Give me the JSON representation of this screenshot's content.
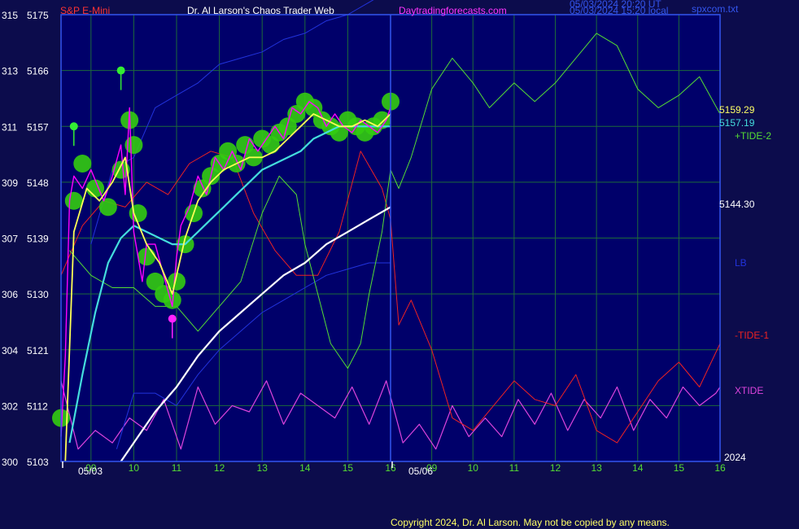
{
  "header": {
    "instrument": "S&P E-Mini",
    "author": "Dr. Al Larson's Chaos Trader Web",
    "site": "Daytradingforecasts.com",
    "ut_time": "05/03/2024 20:20 UT",
    "local_time": "05/03/2024 15:20 local",
    "file": "spxcom.txt"
  },
  "copyright": "Copyright 2024, Dr. Al Larson. May not be copied by any means.",
  "colors": {
    "background": "#0c0c4c",
    "plot_bg": "#00006a",
    "grid": "#1d6a3a",
    "price": "#ff00ff",
    "bubble": "#33cc11",
    "fast_ma": "#ffff55",
    "slow_ma": "#44dddd",
    "long_ma": "#ffffff",
    "tide2": "#55dd33",
    "tide1": "#ee2222",
    "xtide": "#dd44dd",
    "lb": "#2233dd",
    "header_red": "#ff3333",
    "header_white": "#ffffff",
    "header_magenta": "#ff33ff"
  },
  "chart_data": {
    "type": "line",
    "title": "S&P E-Mini",
    "x_ticks_day1": [
      "09",
      "10",
      "11",
      "12",
      "13",
      "14",
      "15",
      "16"
    ],
    "x_ticks_day2": [
      "09",
      "10",
      "11",
      "12",
      "13",
      "14",
      "15",
      "16"
    ],
    "date_labels": [
      "05/03",
      "05/06"
    ],
    "year_label": "2024",
    "y_left_outer": [
      300,
      302,
      304,
      306,
      307,
      309,
      311,
      313,
      315
    ],
    "y_left_inner": [
      5103,
      5112,
      5121,
      5130,
      5139,
      5148,
      5157,
      5166,
      5175
    ],
    "ylim": [
      5103,
      5175
    ],
    "right_labels": {
      "last_price": "5159.29",
      "slow_ma_value": "5157.19",
      "tide2": "+TIDE-2",
      "long_ma_value": "5144.30",
      "lb": "LB",
      "tide1": "-TIDE-1",
      "xtide": "XTIDE"
    },
    "series": [
      {
        "name": "Price",
        "key": "price",
        "x": [
          8.3,
          8.4,
          8.5,
          8.6,
          8.8,
          9.0,
          9.3,
          9.5,
          9.7,
          9.8,
          9.9,
          10.0,
          10.2,
          10.3,
          10.5,
          10.7,
          10.9,
          11.0,
          11.1,
          11.3,
          11.5,
          11.7,
          11.9,
          12.1,
          12.3,
          12.5,
          12.7,
          12.9,
          13.1,
          13.3,
          13.5,
          13.7,
          13.9,
          14.1,
          14.3,
          14.5,
          14.7,
          14.9,
          15.1,
          15.3,
          15.5,
          15.7,
          15.9,
          16.0
        ],
        "y": [
          5107,
          5120,
          5145,
          5149,
          5147,
          5150,
          5145,
          5149,
          5154,
          5146,
          5160,
          5140,
          5132,
          5138,
          5138,
          5133,
          5128,
          5136,
          5141,
          5144,
          5149,
          5146,
          5152,
          5150,
          5153,
          5150,
          5155,
          5153,
          5155,
          5157,
          5155,
          5160,
          5159,
          5161,
          5160,
          5157,
          5159,
          5157,
          5156,
          5158,
          5157,
          5156,
          5158,
          5160
        ]
      },
      {
        "name": "Fast MA",
        "key": "fast_ma",
        "x": [
          8.4,
          8.6,
          8.9,
          9.2,
          9.5,
          9.8,
          10.0,
          10.3,
          10.6,
          10.9,
          11.2,
          11.5,
          11.8,
          12.1,
          12.4,
          12.7,
          13.0,
          13.3,
          13.6,
          13.9,
          14.2,
          14.5,
          14.8,
          15.1,
          15.4,
          15.7,
          16.0
        ],
        "y": [
          5103,
          5140,
          5147,
          5145,
          5148,
          5152,
          5143,
          5138,
          5135,
          5130,
          5139,
          5145,
          5148,
          5150,
          5151,
          5152,
          5152,
          5153,
          5155,
          5157,
          5159,
          5158,
          5157,
          5157,
          5158,
          5157,
          5159
        ]
      },
      {
        "name": "Slow MA",
        "key": "slow_ma",
        "x": [
          8.5,
          8.8,
          9.1,
          9.4,
          9.7,
          10.0,
          10.3,
          10.6,
          10.9,
          11.2,
          11.5,
          11.8,
          12.1,
          12.4,
          12.7,
          13.0,
          13.3,
          13.6,
          13.9,
          14.2,
          14.5,
          14.8,
          15.1,
          15.4,
          15.7,
          16.0
        ],
        "y": [
          5106,
          5117,
          5127,
          5135,
          5139,
          5141,
          5140,
          5139,
          5138,
          5138,
          5140,
          5142,
          5144,
          5146,
          5148,
          5150,
          5151,
          5152,
          5153,
          5155,
          5156,
          5157,
          5157,
          5157,
          5157,
          5157
        ]
      },
      {
        "name": "Long MA",
        "key": "long_ma",
        "x": [
          9.7,
          10.0,
          10.5,
          11.0,
          11.5,
          12.0,
          12.5,
          13.0,
          13.5,
          14.0,
          14.5,
          15.0,
          15.5,
          16.0
        ],
        "y": [
          5103,
          5106,
          5111,
          5115,
          5120,
          5124,
          5127,
          5130,
          5133,
          5135,
          5138,
          5140,
          5142,
          5144
        ]
      },
      {
        "name": "TIDE-2",
        "key": "tide2",
        "x": [
          8.5,
          9.0,
          9.5,
          10.0,
          10.5,
          11.0,
          11.5,
          12.0,
          12.5,
          13.0,
          13.4,
          13.8,
          14.0,
          14.3,
          14.6,
          15.0,
          15.3,
          15.5,
          15.8,
          16.0,
          16.2,
          16.5,
          17.0,
          17.5,
          18.0,
          18.4,
          19.0,
          19.5,
          20.0,
          20.5,
          21.0,
          21.5,
          22.0,
          22.5,
          23.0,
          23.5,
          24.0
        ],
        "y": [
          5137,
          5133,
          5131,
          5131,
          5128,
          5128,
          5124,
          5128,
          5132,
          5143,
          5149,
          5146,
          5138,
          5130,
          5122,
          5118,
          5122,
          5130,
          5140,
          5150,
          5147,
          5152,
          5163,
          5168,
          5164,
          5160,
          5164,
          5161,
          5164,
          5168,
          5172,
          5170,
          5163,
          5160,
          5162,
          5165,
          5159
        ]
      },
      {
        "name": "TIDE-1",
        "key": "tide1",
        "x": [
          8.3,
          8.8,
          9.3,
          9.8,
          10.3,
          10.8,
          11.3,
          11.8,
          12.3,
          12.8,
          13.3,
          13.8,
          14.3,
          14.8,
          15.3,
          15.8,
          16.0,
          16.2,
          16.5,
          17.0,
          17.5,
          18.0,
          18.5,
          19.0,
          19.5,
          20.0,
          20.5,
          21.0,
          21.5,
          22.0,
          22.5,
          23.0,
          23.5,
          24.0
        ],
        "y": [
          5133,
          5141,
          5145,
          5144,
          5148,
          5146,
          5151,
          5153,
          5152,
          5143,
          5137,
          5133,
          5133,
          5140,
          5153,
          5147,
          5142,
          5125,
          5129,
          5121,
          5110,
          5108,
          5112,
          5116,
          5113,
          5112,
          5117,
          5108,
          5106,
          5111,
          5116,
          5119,
          5115,
          5122
        ]
      },
      {
        "name": "XTIDE",
        "key": "xtide",
        "x": [
          8.3,
          8.7,
          9.1,
          9.5,
          9.9,
          10.3,
          10.7,
          11.1,
          11.5,
          11.9,
          12.3,
          12.7,
          13.1,
          13.5,
          13.9,
          14.3,
          14.7,
          15.1,
          15.5,
          15.9,
          16.3,
          16.7,
          17.1,
          17.5,
          17.9,
          18.3,
          18.7,
          19.1,
          19.5,
          19.9,
          20.3,
          20.7,
          21.1,
          21.5,
          21.9,
          22.3,
          22.7,
          23.1,
          23.5,
          23.9,
          24.0
        ],
        "y": [
          5116,
          5105,
          5108,
          5106,
          5110,
          5108,
          5113,
          5105,
          5115,
          5109,
          5112,
          5111,
          5116,
          5109,
          5114,
          5112,
          5110,
          5115,
          5109,
          5116,
          5106,
          5109,
          5105,
          5112,
          5107,
          5110,
          5107,
          5113,
          5109,
          5114,
          5108,
          5113,
          5110,
          5115,
          5108,
          5113,
          5110,
          5115,
          5112,
          5114,
          5115
        ]
      },
      {
        "name": "LB Upper",
        "key": "lb",
        "x": [
          9.0,
          9.5,
          10.0,
          10.5,
          11.0,
          11.5,
          12.0,
          12.5,
          13.0,
          13.5,
          14.0,
          14.5,
          15.0,
          15.5,
          16.0
        ],
        "y": [
          5138,
          5150,
          5152,
          5160,
          5162,
          5164,
          5167,
          5168,
          5169,
          5171,
          5172,
          5174,
          5175,
          5177,
          5179
        ]
      },
      {
        "name": "LB Lower",
        "key": "lb",
        "x": [
          9.6,
          10.0,
          10.5,
          11.0,
          11.5,
          12.0,
          12.5,
          13.0,
          13.5,
          14.0,
          14.5,
          15.0,
          15.5,
          16.0
        ],
        "y": [
          5105,
          5114,
          5114,
          5112,
          5117,
          5121,
          5124,
          5127,
          5129,
          5131,
          5133,
          5134,
          5135,
          5135
        ]
      }
    ],
    "bubbles": [
      {
        "x": 8.3,
        "y": 5110
      },
      {
        "x": 8.6,
        "y": 5145
      },
      {
        "x": 8.8,
        "y": 5151
      },
      {
        "x": 9.1,
        "y": 5147
      },
      {
        "x": 9.4,
        "y": 5144
      },
      {
        "x": 9.7,
        "y": 5150
      },
      {
        "x": 9.9,
        "y": 5158
      },
      {
        "x": 10.0,
        "y": 5154
      },
      {
        "x": 10.1,
        "y": 5143
      },
      {
        "x": 10.3,
        "y": 5136
      },
      {
        "x": 10.5,
        "y": 5132
      },
      {
        "x": 10.7,
        "y": 5130
      },
      {
        "x": 10.9,
        "y": 5129
      },
      {
        "x": 11.0,
        "y": 5132
      },
      {
        "x": 11.2,
        "y": 5138
      },
      {
        "x": 11.4,
        "y": 5143
      },
      {
        "x": 11.6,
        "y": 5147
      },
      {
        "x": 11.8,
        "y": 5149
      },
      {
        "x": 12.0,
        "y": 5151
      },
      {
        "x": 12.2,
        "y": 5153
      },
      {
        "x": 12.4,
        "y": 5151
      },
      {
        "x": 12.6,
        "y": 5154
      },
      {
        "x": 12.8,
        "y": 5152
      },
      {
        "x": 13.0,
        "y": 5155
      },
      {
        "x": 13.2,
        "y": 5154
      },
      {
        "x": 13.4,
        "y": 5156
      },
      {
        "x": 13.6,
        "y": 5157
      },
      {
        "x": 13.8,
        "y": 5159
      },
      {
        "x": 14.0,
        "y": 5161
      },
      {
        "x": 14.2,
        "y": 5160
      },
      {
        "x": 14.4,
        "y": 5158
      },
      {
        "x": 14.6,
        "y": 5157
      },
      {
        "x": 14.8,
        "y": 5156
      },
      {
        "x": 15.0,
        "y": 5158
      },
      {
        "x": 15.2,
        "y": 5157
      },
      {
        "x": 15.4,
        "y": 5156
      },
      {
        "x": 15.6,
        "y": 5157
      },
      {
        "x": 15.8,
        "y": 5158
      },
      {
        "x": 16.0,
        "y": 5161
      }
    ],
    "markers": [
      {
        "x": 9.7,
        "y": 5166,
        "color": "#33ee33"
      },
      {
        "x": 8.6,
        "y": 5157,
        "color": "#33ee33"
      },
      {
        "x": 10.9,
        "y": 5126,
        "color": "#ff22ff"
      }
    ]
  }
}
